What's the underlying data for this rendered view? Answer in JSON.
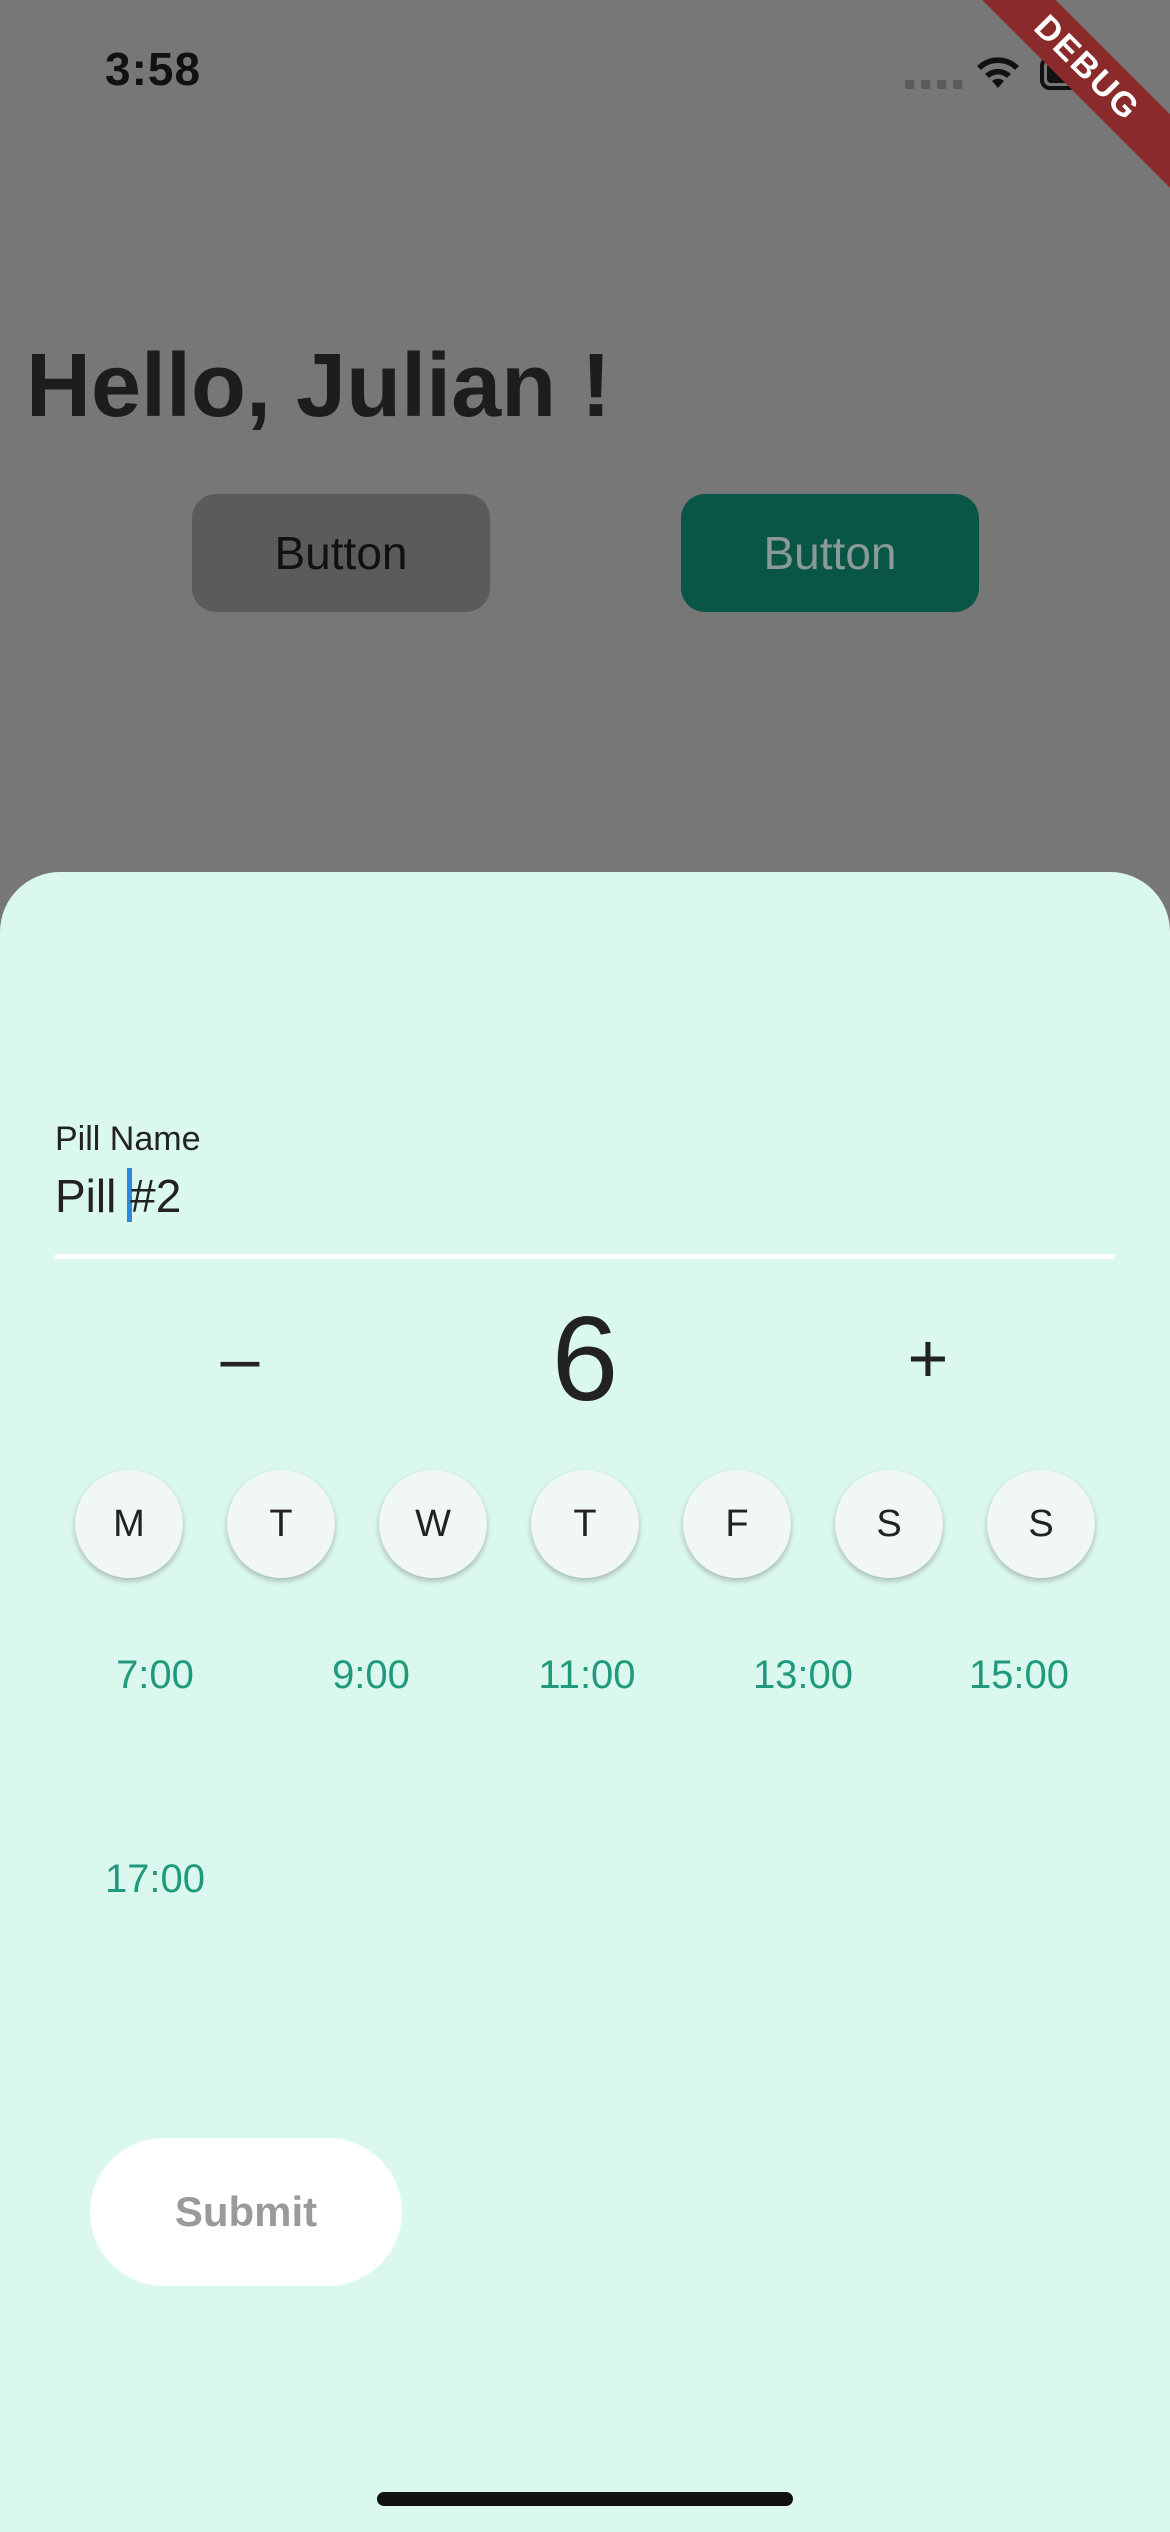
{
  "status_bar": {
    "time": "3:58"
  },
  "debug_banner": {
    "label": "DEBUG"
  },
  "background": {
    "greeting": "Hello, Julian !",
    "button_left_label": "Button",
    "button_right_label": "Button"
  },
  "sheet": {
    "pill_name_label": "Pill Name",
    "pill_name_value_before_caret": "Pill ",
    "pill_name_value_after_caret": "#2",
    "stepper": {
      "minus": "–",
      "value": "6",
      "plus": "+"
    },
    "days": [
      "M",
      "T",
      "W",
      "T",
      "F",
      "S",
      "S"
    ],
    "times": [
      "7:00",
      "9:00",
      "11:00",
      "13:00",
      "15:00",
      "17:00"
    ],
    "submit_label": "Submit"
  },
  "colors": {
    "overlay": "#777777",
    "sheet_bg": "#dbf8ef",
    "accent_green": "#1f9a7d",
    "button_dark_green": "#0a5646",
    "debug_red": "#8b2a2a"
  }
}
